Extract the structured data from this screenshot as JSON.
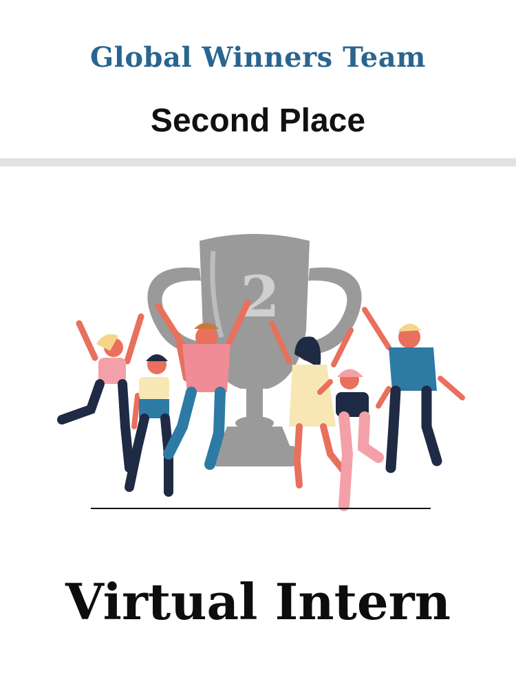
{
  "header": {
    "team_title": "Global Winners Team",
    "place_title": "Second Place"
  },
  "illustration": {
    "trophy_number": "2",
    "trophy_color": "#9a9a9a",
    "people_count": 6
  },
  "footer": {
    "title": "Virtual Intern"
  },
  "colors": {
    "team_title": "#2a6590",
    "divider": "#e2e2e2",
    "text": "#111111"
  }
}
